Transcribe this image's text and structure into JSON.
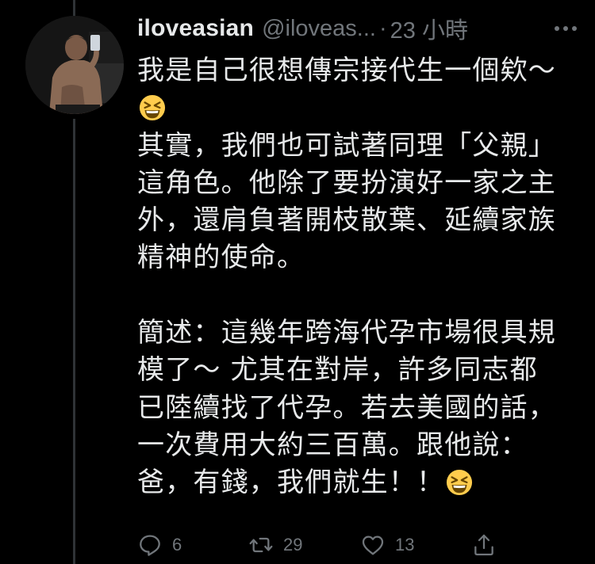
{
  "tweet": {
    "display_name": "iloveasian",
    "handle": "@iloveas...",
    "separator": "·",
    "timestamp": "23 小時",
    "lines": [
      "我是自己很想傳宗接代生一個欸～",
      "",
      "其實，我們也可試著同理「父親」",
      "這角色。他除了要扮演好一家之主",
      "外，還肩負著開枝散葉、延續家族",
      "精神的使命。",
      "",
      "",
      "簡述：這幾年跨海代孕市場很具規",
      "模了～ 尤其在對岸，許多同志都",
      "已陸續找了代孕。若去美國的話，",
      "一次費用大約三百萬。跟他說：",
      "爸，有錢，我們就生！！"
    ],
    "emoji": "grinning-squinting-face"
  },
  "actions": {
    "reply_count": "6",
    "retweet_count": "29",
    "like_count": "13"
  },
  "colors": {
    "background": "#000000",
    "text": "#e7e9ea",
    "secondary": "#71767b",
    "emoji_face": "#ffcc4d"
  },
  "icons": {
    "more": "more-horizontal-icon",
    "reply": "reply-icon",
    "retweet": "retweet-icon",
    "like": "heart-icon",
    "share": "share-icon"
  }
}
